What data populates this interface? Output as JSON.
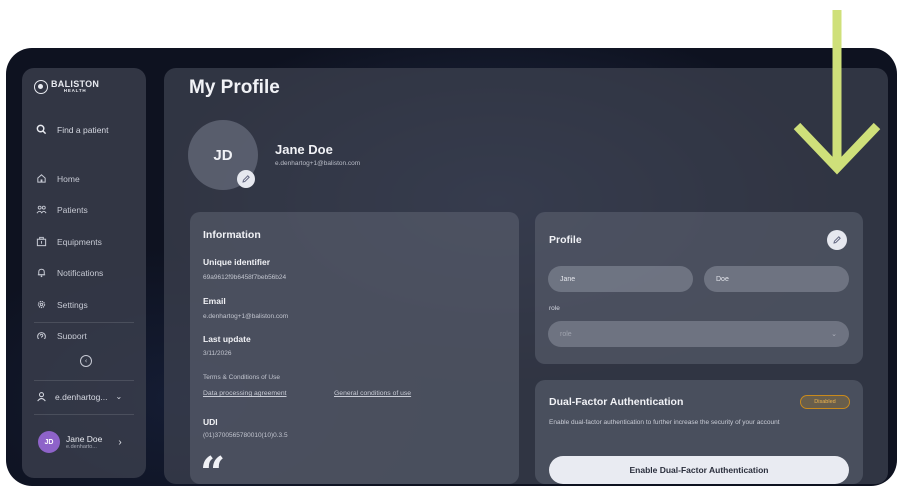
{
  "brand": {
    "name": "BALISTON",
    "sub": "HEALTH"
  },
  "sidebar": {
    "search_label": "Find a patient",
    "items": [
      {
        "label": "Home",
        "icon": "home-icon"
      },
      {
        "label": "Patients",
        "icon": "patients-icon"
      },
      {
        "label": "Equipments",
        "icon": "equipments-icon"
      },
      {
        "label": "Notifications",
        "icon": "bell-icon"
      },
      {
        "label": "Settings",
        "icon": "gear-icon"
      },
      {
        "label": "Support",
        "icon": "support-icon"
      }
    ],
    "org_label": "e.denhartog...",
    "user": {
      "initials": "JD",
      "name": "Jane Doe",
      "email": "e.denharto..."
    }
  },
  "page": {
    "title": "My Profile"
  },
  "profile_header": {
    "initials": "JD",
    "name": "Jane Doe",
    "email": "e.denhartog+1@baliston.com"
  },
  "information": {
    "title": "Information",
    "unique_identifier_label": "Unique identifier",
    "unique_identifier": "69a9612f9b6458f7beb56b24",
    "email_label": "Email",
    "email": "e.denhartog+1@baliston.com",
    "last_update_label": "Last update",
    "last_update": "3/11/2026",
    "terms_label": "Terms & Conditions of Use",
    "link_data_processing": "Data processing agreement",
    "link_general_conditions": "General conditions of use",
    "udi_label": "UDI",
    "udi": "(01)3700565780010(10)0.3.5",
    "quote_glyph": "“"
  },
  "profile_form": {
    "title": "Profile",
    "first_name": "Jane",
    "last_name": "Doe",
    "role_label": "role",
    "role_placeholder": "role"
  },
  "two_factor": {
    "title": "Dual-Factor Authentication",
    "status": "Disabled",
    "description": "Enable dual-factor authentication to further increase the security of your account",
    "button_label": "Enable Dual-Factor Authentication"
  },
  "colors": {
    "arrow": "#cfe07a",
    "status_disabled": "#f0b44c",
    "avatar": "#8e63c9"
  }
}
